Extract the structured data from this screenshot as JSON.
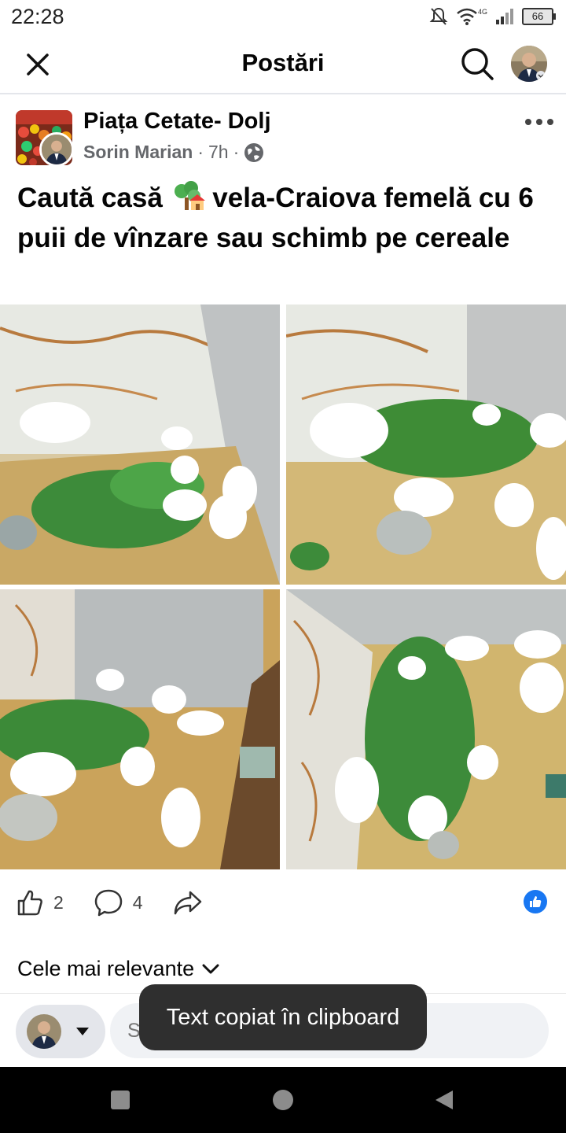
{
  "status_bar": {
    "time": "22:28",
    "network": "4G",
    "battery": "66"
  },
  "header": {
    "title": "Postări",
    "close_icon": "close-icon",
    "search_icon": "search-icon"
  },
  "post": {
    "group_name": "Piața Cetate- Dolj",
    "author": "Sorin Marian",
    "time": "7h",
    "separator": "·",
    "audience_icon": "globe-icon",
    "text_part1": "Caută casă",
    "text_part2": "vela-Craiova femelă cu 6 puii de vînzare sau schimb pe cereale",
    "photos": [
      "photo-1",
      "photo-2",
      "photo-3",
      "photo-4"
    ]
  },
  "actions": {
    "like_count": "2",
    "comment_count": "4"
  },
  "comments": {
    "sort_label": "Cele mai relevante"
  },
  "composer": {
    "placeholder": "Scrie un comentariu..."
  },
  "toast": {
    "message": "Text copiat în clipboard"
  },
  "colors": {
    "brand_blue": "#1877f2",
    "text": "#050505",
    "secondary": "#65676b"
  }
}
